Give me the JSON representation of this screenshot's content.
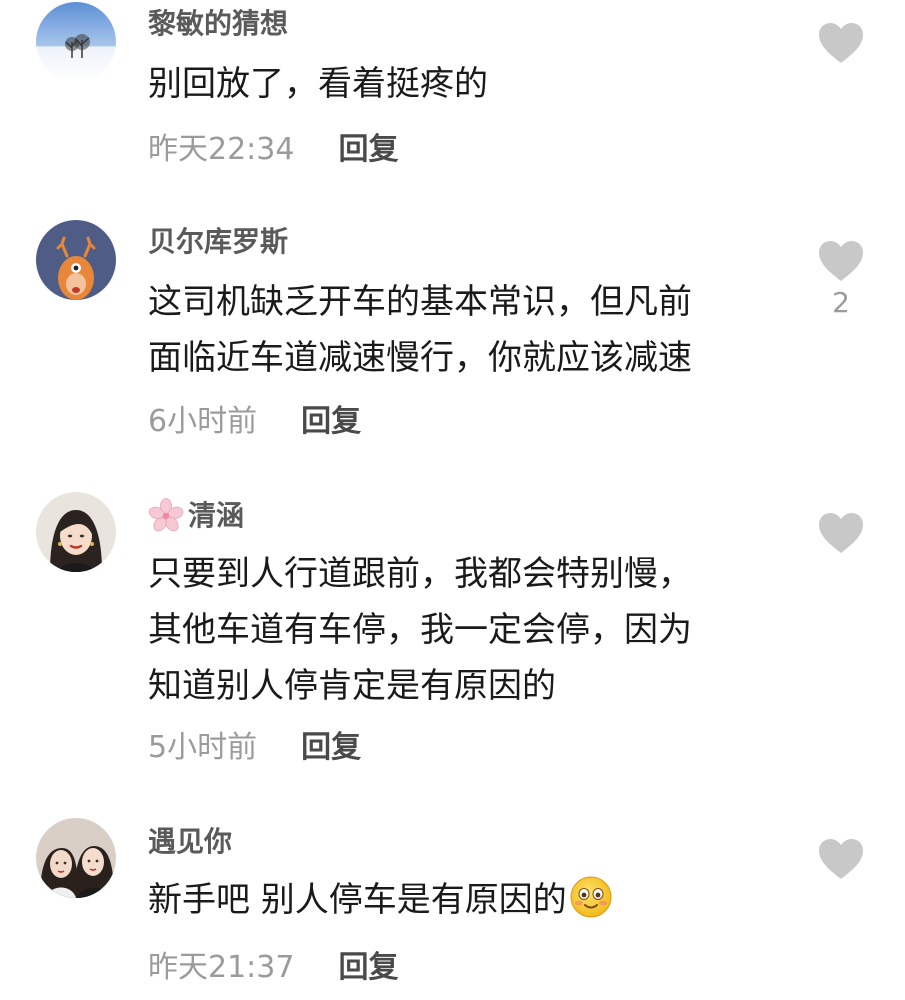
{
  "comments": [
    {
      "username": "黎敏的猜想",
      "lines": [
        "别回放了，看着挺疼的"
      ],
      "time": "昨天22:34",
      "reply_label": "回复",
      "likes": null,
      "avatar": "snowy-trees-avatar"
    },
    {
      "username": "贝尔库罗斯",
      "lines": [
        "这司机缺乏开车的基本常识，但凡前",
        "面临近车道减速慢行，你就应该减速"
      ],
      "time": "6小时前",
      "reply_label": "回复",
      "likes": "2",
      "avatar": "cartoon-deer-avatar"
    },
    {
      "username": "清涵",
      "lines": [
        "只要到人行道跟前，我都会特别慢，",
        "其他车道有车停，我一定会停，因为",
        "知道别人停肯定是有原因的"
      ],
      "time": "5小时前",
      "reply_label": "回复",
      "likes": null,
      "avatar": "woman-portrait-avatar",
      "badge_icon": "cherry-blossom-icon"
    },
    {
      "username": "遇见你",
      "lines": [
        "新手吧 别人停车是有原因的"
      ],
      "time": "昨天21:37",
      "reply_label": "回复",
      "likes": null,
      "avatar": "two-women-avatar",
      "trailing_icon": "smiling-face-emoji"
    }
  ],
  "colors": {
    "username": "#5a5a5a",
    "text": "#1a1a1a",
    "time": "#9b9b9b",
    "reply": "#4a4a4a",
    "like_icon": "#c8c8c8"
  }
}
